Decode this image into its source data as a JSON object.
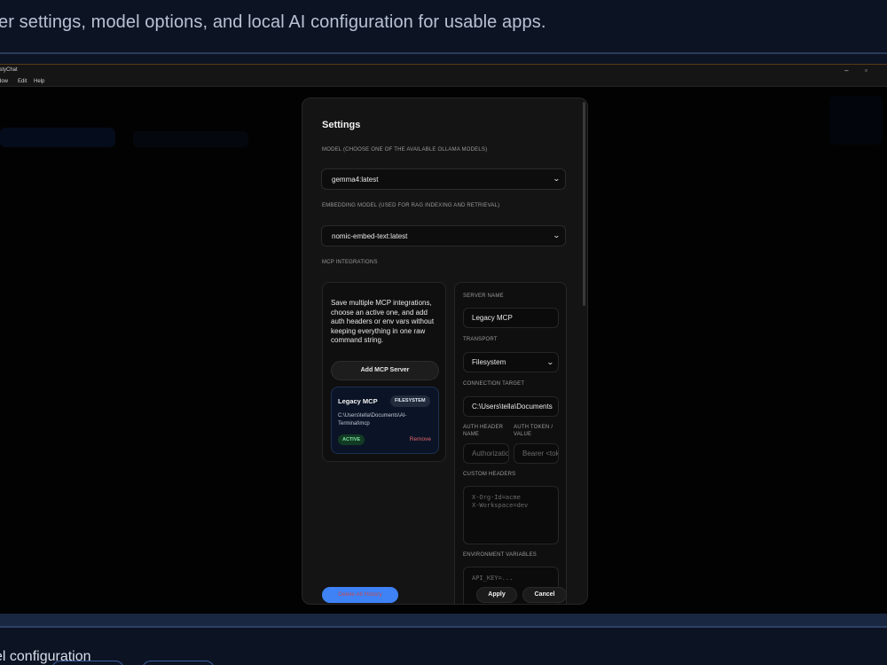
{
  "page": {
    "subtitle": "er settings, model options, and local AI configuration for usable apps.",
    "footer_text": "el configuration"
  },
  "window": {
    "title": "ustyChat",
    "menu": [
      "dow",
      "Edit",
      "Help"
    ],
    "minimize_glyph": "–",
    "restore_glyph": "▫"
  },
  "settings": {
    "title": "Settings",
    "model_label": "MODEL (CHOOSE ONE OF THE AVAILABLE OLLAMA MODELS)",
    "model_value": "gemma4:latest",
    "embedding_label": "EMBEDDING MODEL (USED FOR RAG INDEXING AND RETRIEVAL)",
    "embedding_value": "nomic-embed-text:latest",
    "mcp_label": "MCP INTEGRATIONS",
    "mcp_intro": "Save multiple MCP integrations, choose an active one, and add auth headers or env vars without keeping everything in one raw command string.",
    "add_server_label": "Add MCP Server",
    "server": {
      "name": "Legacy MCP",
      "badge": "FILESYSTEM",
      "path": "C:\\Users\\tella\\Documents\\AI-Terminal\\mcp",
      "status": "ACTIVE",
      "remove_label": "Remove"
    },
    "form": {
      "server_name_label": "SERVER NAME",
      "server_name_value": "Legacy MCP",
      "transport_label": "TRANSPORT",
      "transport_value": "Filesystem",
      "target_label": "CONNECTION TARGET",
      "target_value": "C:\\Users\\tella\\Documents",
      "auth_header_label": "AUTH HEADER NAME",
      "auth_header_placeholder": "Authorization",
      "auth_token_label": "AUTH TOKEN / VALUE",
      "auth_token_placeholder": "Bearer <token>",
      "custom_headers_label": "CUSTOM HEADERS",
      "custom_headers_placeholder": "X-Org-Id=acme\nX-Workspace=dev",
      "env_label": "ENVIRONMENT VARIABLES",
      "env_placeholder": "API_KEY=..."
    },
    "danger_button": "Delete All History",
    "apply_button": "Apply",
    "cancel_button": "Cancel"
  },
  "colors": {
    "accent": "#3f82f6",
    "active_badge": "#7be0a0",
    "remove": "#e0666a"
  }
}
